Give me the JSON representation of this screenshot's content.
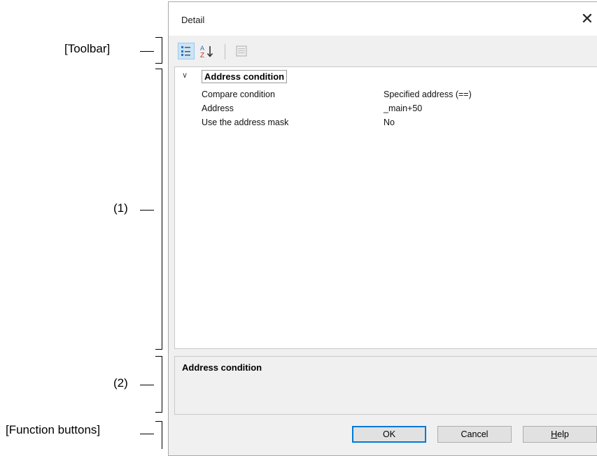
{
  "callouts": {
    "toolbar": "[Toolbar]",
    "grid": "(1)",
    "description": "(2)",
    "buttons": "[Function buttons]"
  },
  "dialog": {
    "title": "Detail",
    "close_glyph": "✕"
  },
  "toolbar": {
    "buttons": [
      {
        "icon": "categorized-view-icon",
        "active": true
      },
      {
        "icon": "sort-alphabetical-icon",
        "active": false
      },
      {
        "icon": "property-pages-icon",
        "enabled": false
      }
    ]
  },
  "property_grid": {
    "category": {
      "label": "Address condition",
      "chevron": "∨",
      "expanded": true
    },
    "rows": [
      {
        "name": "Compare condition",
        "value": "Specified address (==)"
      },
      {
        "name": "Address",
        "value": "_main+50"
      },
      {
        "name": "Use the address mask",
        "value": "No"
      }
    ]
  },
  "description": {
    "title": "Address condition"
  },
  "buttons": {
    "ok": "OK",
    "cancel": "Cancel",
    "help_accel": "H",
    "help_rest": "elp"
  },
  "colors": {
    "dialog_bg": "#f0f0f0",
    "default_button_border": "#0078d7",
    "toolbar_icon_blue": "#2f6fbf"
  }
}
